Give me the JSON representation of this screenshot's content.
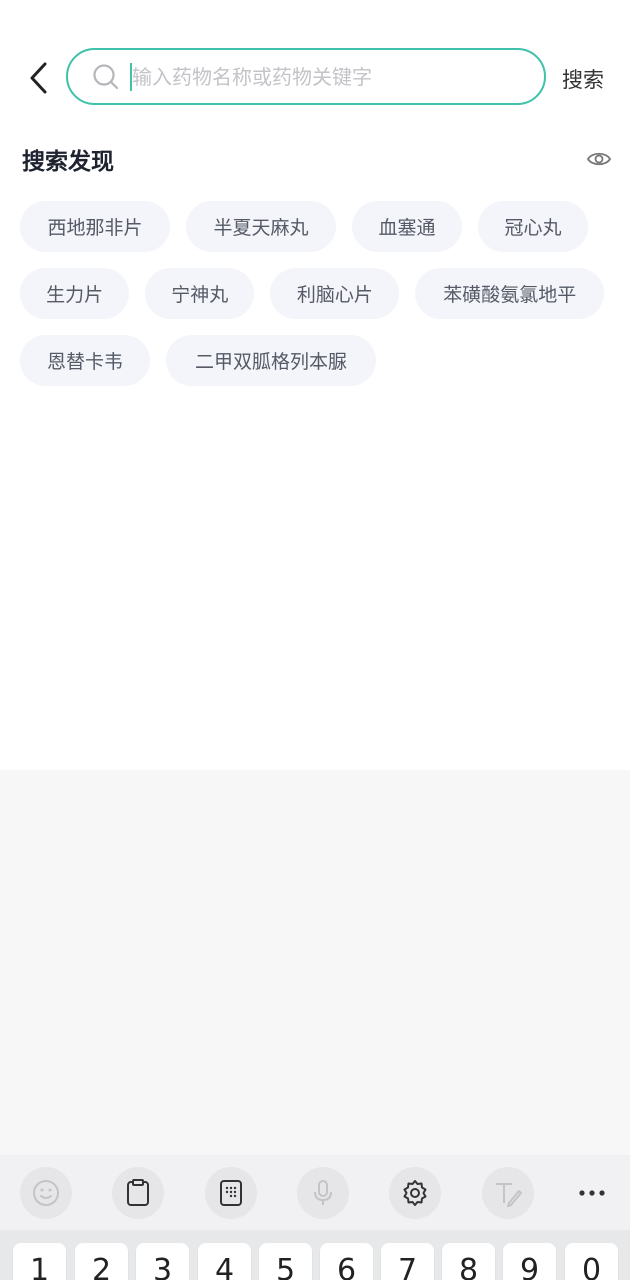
{
  "search": {
    "placeholder": "输入药物名称或药物关键字",
    "button_label": "搜索"
  },
  "discover": {
    "title": "搜索发现",
    "rows": [
      [
        "西地那非片",
        "半夏天麻丸",
        "血塞通",
        "冠心丸"
      ],
      [
        "生力片",
        "宁神丸",
        "利脑心片",
        "苯磺酸氨氯地平"
      ],
      [
        "恩替卡韦",
        "二甲双胍格列本脲"
      ]
    ]
  },
  "keyboard": {
    "toolbar": [
      "emoji-icon",
      "clipboard-icon",
      "keypad-icon",
      "microphone-icon",
      "settings-icon",
      "handwriting-icon",
      "more-icon"
    ],
    "keys": [
      "1",
      "2",
      "3",
      "4",
      "5",
      "6",
      "7",
      "8",
      "9",
      "0"
    ]
  },
  "colors": {
    "accent": "#3fc2a9",
    "chip_bg": "#f4f5fa",
    "chip_text": "#555a66"
  }
}
